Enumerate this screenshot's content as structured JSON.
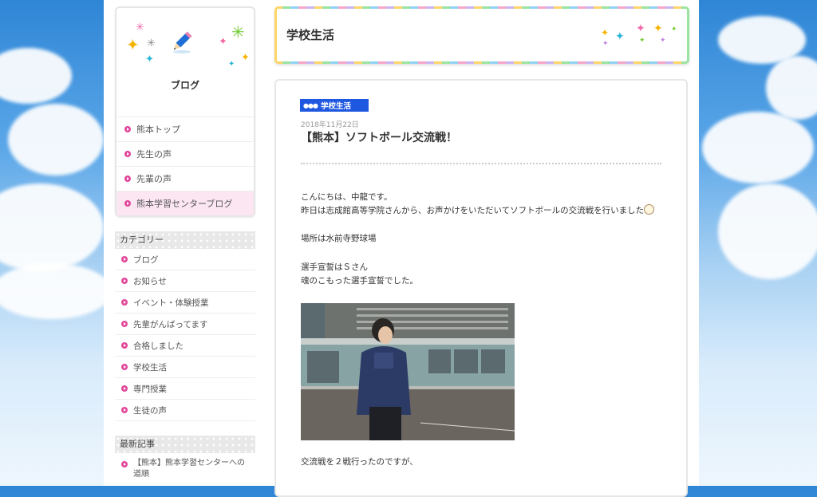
{
  "sidebar": {
    "blog_title": "ブログ",
    "nav": [
      "熊本トップ",
      "先生の声",
      "先輩の声",
      "熊本学習センターブログ"
    ],
    "category_heading": "カテゴリー",
    "categories": [
      "ブログ",
      "お知らせ",
      "イベント・体験授業",
      "先輩がんばってます",
      "合格しました",
      "学校生活",
      "専門授業",
      "生徒の声"
    ],
    "recent_heading": "最新記事",
    "recent_posts": [
      "【熊本】熊本学習センターへの道順"
    ]
  },
  "header": {
    "title": "学校生活"
  },
  "post": {
    "category_badge": "学校生活",
    "date": "2018年11月22日",
    "title": "【熊本】ソフトボール交流戦！",
    "greeting": "こんにちは、中龍です。",
    "line1": "昨日は志成館高等学院さんから、お声かけをいただいてソフトボールの交流戦を行いました",
    "place": "場所は水前寺野球場",
    "oath1": "選手宣誓はＳさん",
    "oath2": "魂のこもった選手宣誓でした。",
    "after_photo": "交流戦を２戦行ったのですが、"
  },
  "colors": {
    "accent_pink": "#e1469a",
    "badge_blue": "#1e57e0"
  },
  "icons": [
    "pencil-icon",
    "sparkle-icon",
    "bullet-arrow-icon",
    "softball-icon"
  ]
}
